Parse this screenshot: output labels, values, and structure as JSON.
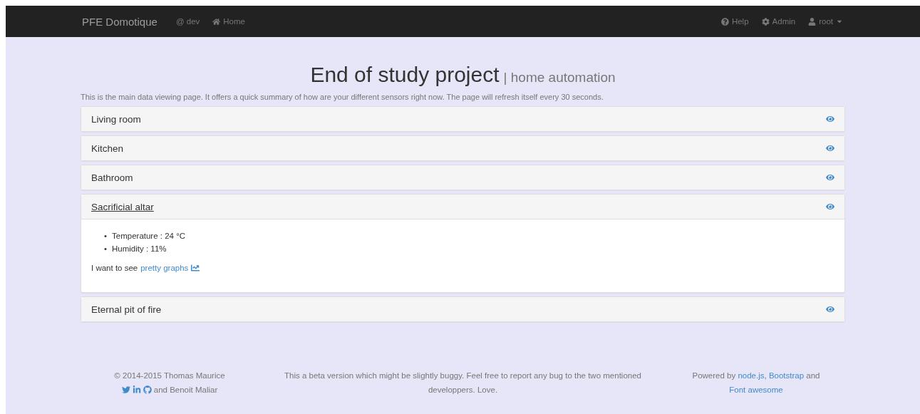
{
  "navbar": {
    "brand": "PFE Domotique",
    "left": [
      {
        "kind": "env",
        "label": "@ dev"
      },
      {
        "kind": "home",
        "label": "Home"
      }
    ],
    "right": [
      {
        "kind": "help",
        "label": "Help"
      },
      {
        "kind": "admin",
        "label": "Admin"
      },
      {
        "kind": "user",
        "label": "root"
      }
    ]
  },
  "header": {
    "title": "End of study project",
    "subtitle": "| home automation",
    "description": "This is the main data viewing page. It offers a quick summary of how are your different sensors right now. The page will refresh itself every 30 seconds."
  },
  "rooms": [
    {
      "name": "Living room",
      "expanded": false
    },
    {
      "name": "Kitchen",
      "expanded": false
    },
    {
      "name": "Bathroom",
      "expanded": false
    },
    {
      "name": "Sacrificial altar",
      "expanded": true,
      "readings": [
        {
          "marker": "•",
          "text": "Temperature : 24 °C"
        },
        {
          "marker": "•",
          "text": "Humidity : 11%"
        }
      ],
      "graphs": {
        "text": "I want to see ",
        "link": "pretty graphs"
      }
    },
    {
      "name": "Eternal pit of fire",
      "expanded": false
    }
  ],
  "footer": {
    "credit_top": "© 2014-2015 Thomas Maurice",
    "credit_bottom": "and Benoit Maliar",
    "note": "This a beta version which might be slightly buggy. Feel free to report any bug to the two mentioned developpers. Love.",
    "powered": [
      {
        "kind": "text",
        "text": "Powered by "
      },
      {
        "kind": "link",
        "text": "node.js"
      },
      {
        "kind": "text",
        "text": ", "
      },
      {
        "kind": "link",
        "text": "Bootstrap"
      },
      {
        "kind": "text",
        "text": " and "
      },
      {
        "kind": "link",
        "text": "Font awesome"
      }
    ]
  }
}
